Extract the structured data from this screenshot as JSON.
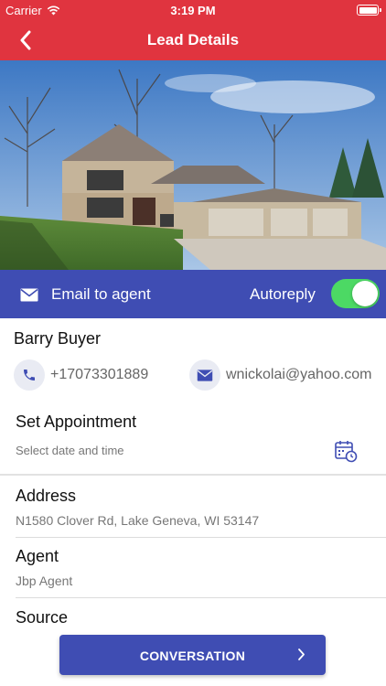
{
  "status_bar": {
    "carrier": "Carrier",
    "time": "3:19 PM",
    "wifi_icon": "wifi-icon",
    "battery_icon": "battery-icon"
  },
  "nav": {
    "title": "Lead Details",
    "back_icon": "chevron-left-icon"
  },
  "hero": {
    "image": "house-photo"
  },
  "strip": {
    "email_label": "Email to agent",
    "autoreply_label": "Autoreply",
    "autoreply_on": true,
    "accent": "#3f4db3",
    "toggle_color": "#4cd964"
  },
  "lead": {
    "name": "Barry Buyer",
    "phone": "+17073301889",
    "email": "wnickolai@yahoo.com"
  },
  "appointment": {
    "title": "Set Appointment",
    "placeholder": "Select date and time"
  },
  "address": {
    "label": "Address",
    "value": "N1580 Clover Rd,  Lake Geneva, WI 53147"
  },
  "agent": {
    "label": "Agent",
    "value": "Jbp Agent"
  },
  "source": {
    "label": "Source"
  },
  "cta": {
    "label": "CONVERSATION"
  },
  "colors": {
    "header": "#e0343f",
    "primary": "#3f4db3"
  }
}
